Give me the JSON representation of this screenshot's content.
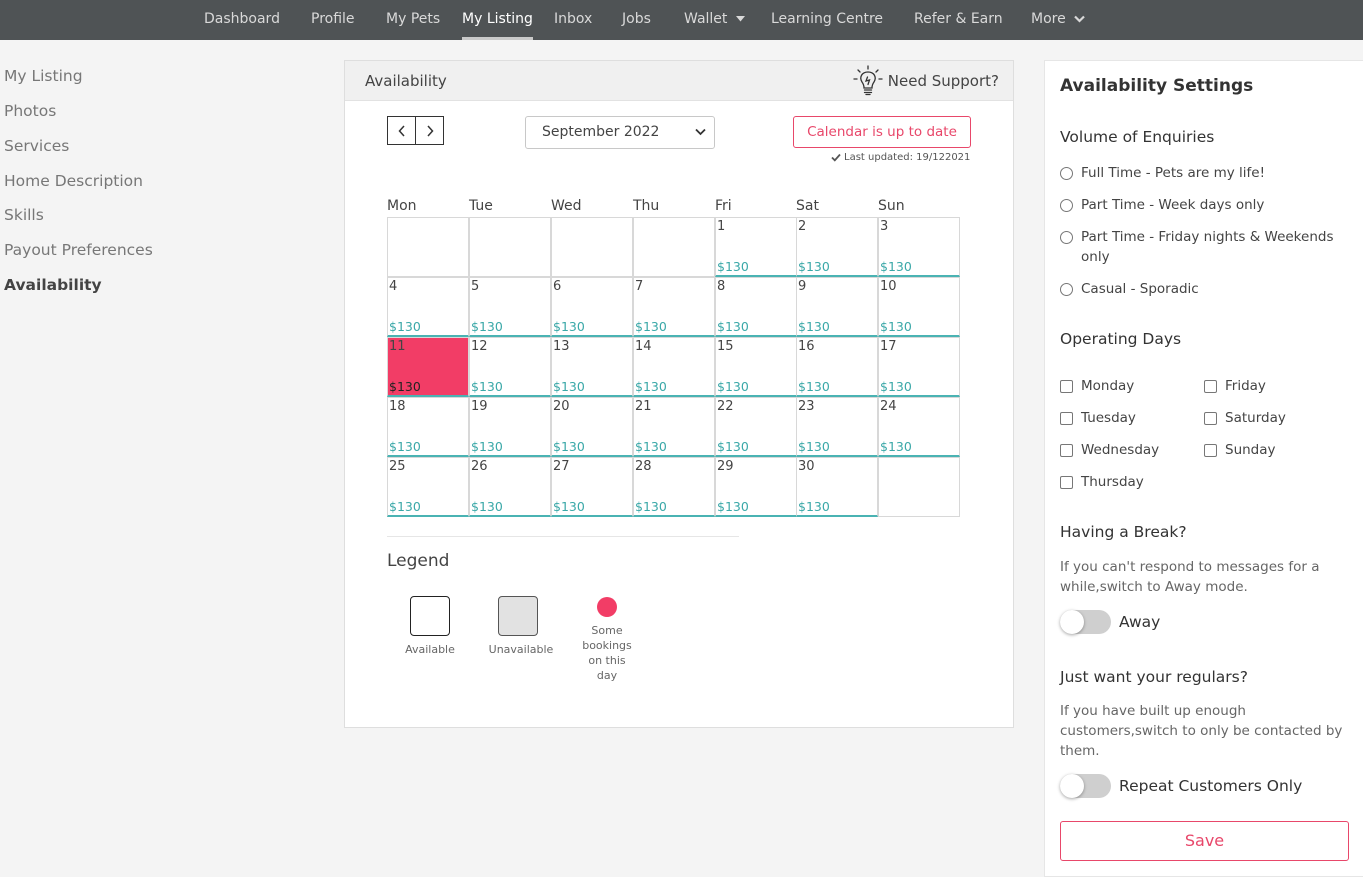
{
  "topnav": {
    "items": [
      {
        "label": "Dashboard"
      },
      {
        "label": "Profile"
      },
      {
        "label": "My Pets"
      },
      {
        "label": "My Listing",
        "active": true
      },
      {
        "label": "Inbox"
      },
      {
        "label": "Jobs"
      },
      {
        "label": "Wallet",
        "caret": true
      },
      {
        "label": "Learning Centre"
      },
      {
        "label": "Refer & Earn"
      },
      {
        "label": "More",
        "caret": true
      }
    ]
  },
  "sidemenu": {
    "items": [
      {
        "label": "My Listing"
      },
      {
        "label": "Photos"
      },
      {
        "label": "Services"
      },
      {
        "label": "Home Description"
      },
      {
        "label": "Skills"
      },
      {
        "label": "Payout Preferences"
      },
      {
        "label": "Availability",
        "active": true
      }
    ]
  },
  "availability": {
    "title": "Availability",
    "support_label": "Need Support?",
    "support_icon": "lightbulb-icon",
    "prev_icon": "chevron-left-icon",
    "next_icon": "chevron-right-icon",
    "month_value": "September 2022",
    "uptodate_label": "Calendar is up to date",
    "last_updated": "Last updated: 19/122021",
    "weekdays": [
      "Mon",
      "Tue",
      "Wed",
      "Thu",
      "Fri",
      "Sat",
      "Sun"
    ],
    "first_weekday_index": 4,
    "days_in_month": 30,
    "price": "$130",
    "booked_days": [
      11
    ],
    "colors": {
      "booked": "#f23d66",
      "price": "#3aa8a8",
      "accent": "#e8476a"
    }
  },
  "legend": {
    "title": "Legend",
    "available": "Available",
    "unavailable": "Unavailable",
    "some_bookings_lines": [
      "Some",
      "bookings",
      "on this",
      "day"
    ]
  },
  "settings": {
    "title": "Availability Settings",
    "volume_title": "Volume of Enquiries",
    "volume_options": [
      "Full Time - Pets are my life!",
      "Part Time - Week days only",
      "Part Time - Friday nights & Weekends only",
      "Casual - Sporadic"
    ],
    "days_title": "Operating Days",
    "days_left": [
      "Monday",
      "Tuesday",
      "Wednesday",
      "Thursday"
    ],
    "days_right": [
      "Friday",
      "Saturday",
      "Sunday"
    ],
    "break_title": "Having a Break?",
    "break_desc": "If you can't respond to messages for a while,switch to Away mode.",
    "away_label": "Away",
    "regulars_title": "Just want your regulars?",
    "regulars_desc": "If you have built up enough customers,switch to only be contacted by them.",
    "repeat_label": "Repeat Customers Only",
    "save_label": "Save"
  }
}
